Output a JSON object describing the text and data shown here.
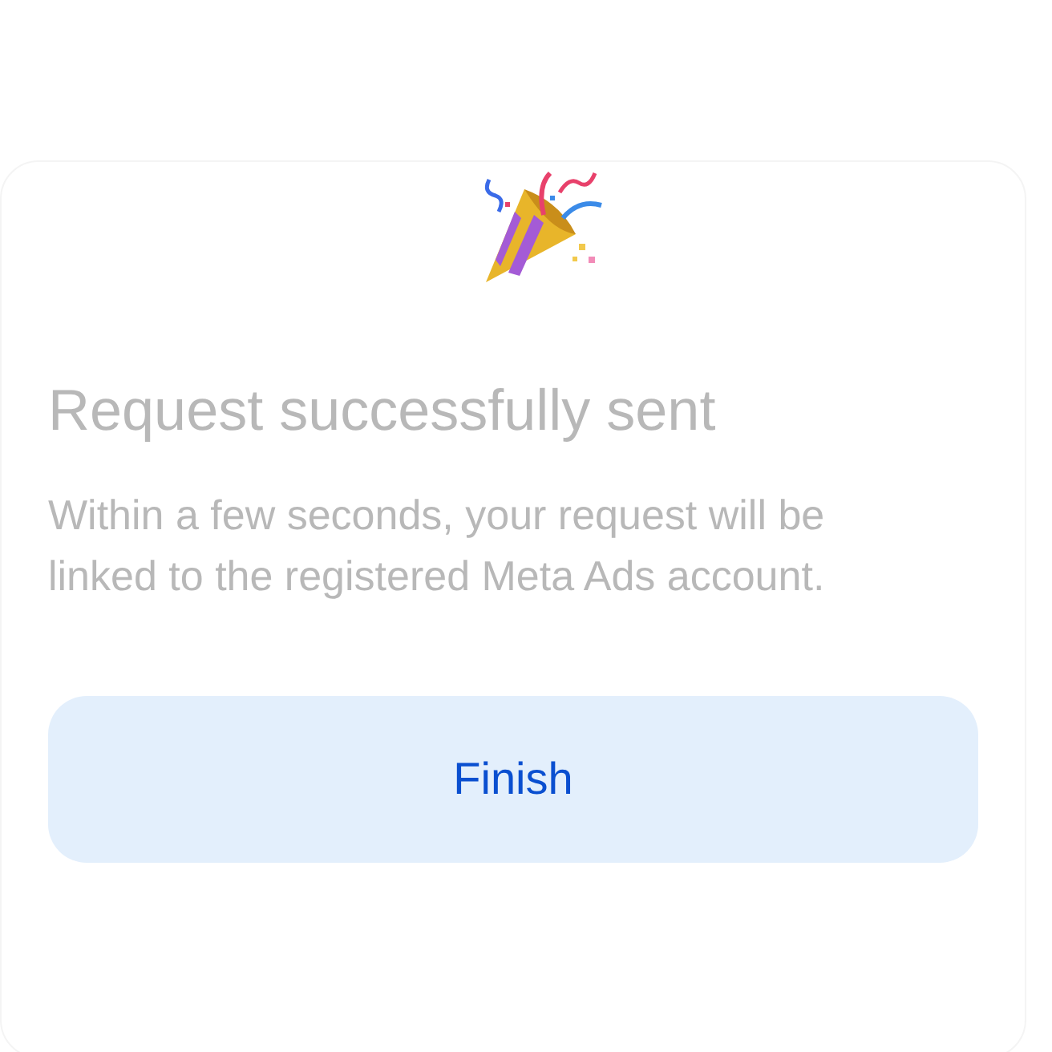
{
  "title": "Request successfully sent",
  "message": "Within a few seconds, your request will be linked to the registered Meta Ads account.",
  "buttons": [
    {
      "label": "Finish",
      "kind": "primary"
    }
  ]
}
